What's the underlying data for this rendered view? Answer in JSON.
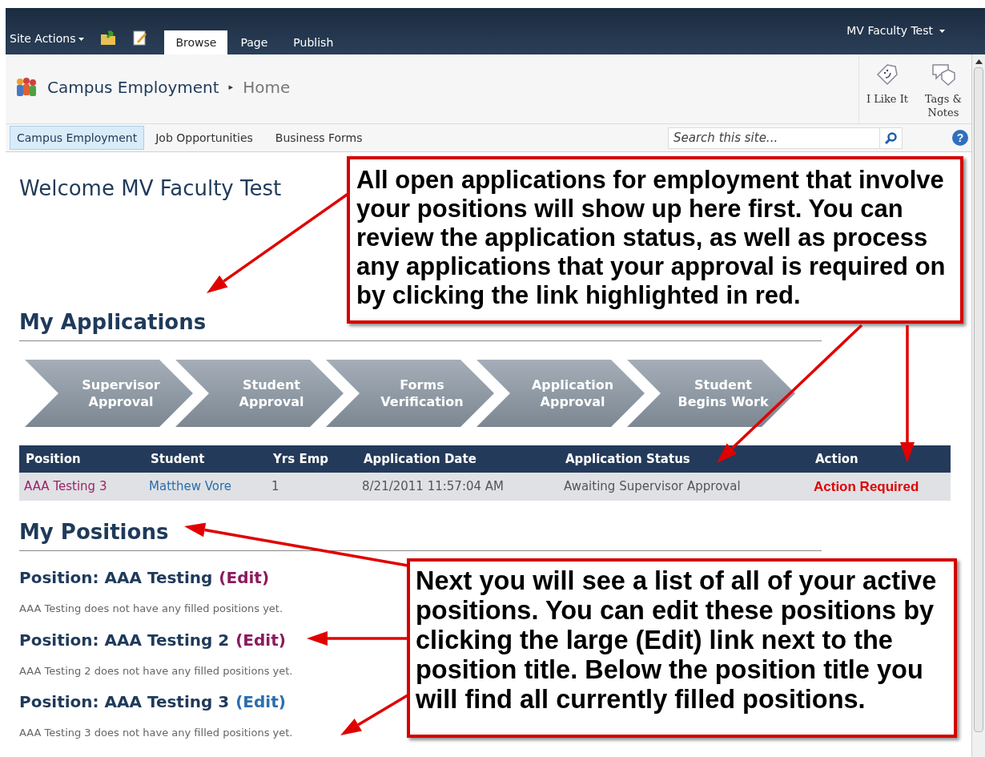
{
  "top_bar": {
    "site_actions": "Site Actions",
    "tabs": [
      {
        "label": "Browse",
        "selected": true
      },
      {
        "label": "Page",
        "selected": false
      },
      {
        "label": "Publish",
        "selected": false
      }
    ],
    "user": "MV Faculty Test"
  },
  "title_area": {
    "site": "Campus Employment",
    "separator": "▸",
    "page": "Home",
    "actions": [
      {
        "kind": "like",
        "label": "I Like It"
      },
      {
        "kind": "tags",
        "label": "Tags & Notes"
      }
    ]
  },
  "nav": {
    "items": [
      {
        "label": "Campus Employment",
        "selected": true
      },
      {
        "label": "Job Opportunities",
        "selected": false
      },
      {
        "label": "Business Forms",
        "selected": false
      }
    ],
    "search": {
      "placeholder": "Search this site..."
    },
    "help": "?"
  },
  "welcome": "Welcome MV Faculty Test",
  "applications": {
    "heading": "My Applications",
    "steps": [
      "Supervisor Approval",
      "Student Approval",
      "Forms Verification",
      "Application Approval",
      "Student Begins Work"
    ],
    "columns": [
      "Position",
      "Student",
      "Yrs Emp",
      "Application Date",
      "Application Status",
      "Action"
    ],
    "rows": [
      {
        "position": "AAA Testing 3",
        "student": "Matthew Vore",
        "yrs_emp": "1",
        "date": "8/21/2011 11:57:04 AM",
        "status": "Awaiting Supervisor Approval",
        "action": "Action Required"
      }
    ]
  },
  "positions": {
    "heading": "My Positions",
    "items": [
      {
        "title": "Position: AAA Testing",
        "edit": "(Edit)",
        "visited": true,
        "note": "AAA Testing does not have any filled positions yet."
      },
      {
        "title": "Position: AAA Testing 2",
        "edit": "(Edit)",
        "visited": true,
        "note": "AAA Testing 2 does not have any filled positions yet."
      },
      {
        "title": "Position: AAA Testing 3",
        "edit": "(Edit)",
        "visited": false,
        "note": "AAA Testing 3 does not have any filled positions yet."
      }
    ]
  },
  "callouts": [
    "All open applications for employment that involve your positions will show up here first. You can review the application status, as well as process any applications that your approval is required on by clicking the link highlighted in red.",
    "Next you will see a list of all of your active positions. You can edit these positions by clicking the large (Edit) link next to the position title.  Below the position title you will find all currently filled positions."
  ]
}
